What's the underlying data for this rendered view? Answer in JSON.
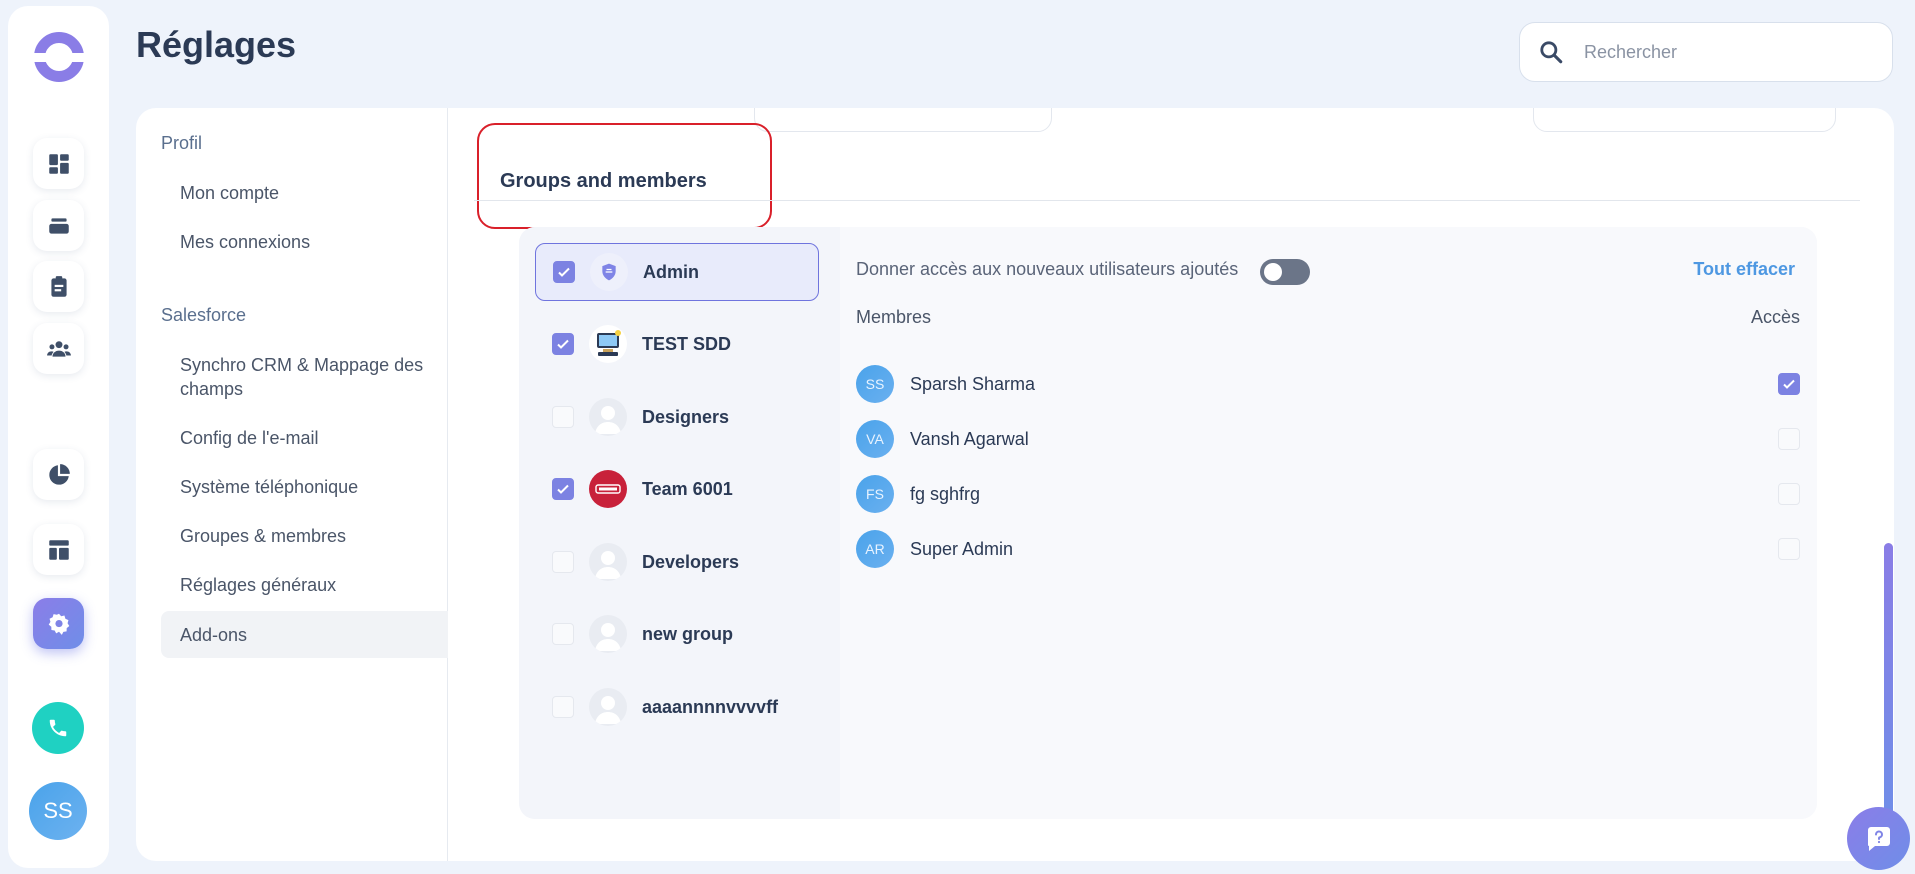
{
  "header": {
    "title": "Réglages",
    "search_placeholder": "Rechercher"
  },
  "rail": {
    "items": [
      {
        "icon": "dashboard-icon"
      },
      {
        "icon": "inbox-icon"
      },
      {
        "icon": "clipboard-icon"
      },
      {
        "icon": "team-icon"
      },
      {
        "icon": "pie-chart-icon"
      },
      {
        "icon": "layout-icon"
      },
      {
        "icon": "gear-icon",
        "active": true
      }
    ],
    "phone_icon": "phone-icon",
    "user_initials": "SS"
  },
  "settings_nav": {
    "sections": [
      {
        "label": "Profil",
        "items": [
          "Mon compte",
          "Mes connexions"
        ]
      },
      {
        "label": "Salesforce",
        "items": [
          "Synchro CRM & Mappage des champs",
          "Config de l'e-mail",
          "Système téléphonique",
          "Groupes & membres",
          "Réglages généraux",
          "Add-ons"
        ]
      }
    ],
    "active_item": "Add-ons"
  },
  "section_title": "Groups and members",
  "groups": [
    {
      "name": "Admin",
      "checked": true,
      "selected": true,
      "avatar": "shield-icon"
    },
    {
      "name": "TEST SDD",
      "checked": true,
      "avatar": "computer-icon"
    },
    {
      "name": "Designers",
      "checked": false,
      "avatar": "person-placeholder-icon"
    },
    {
      "name": "Team 6001",
      "checked": true,
      "avatar": "red-logo-icon"
    },
    {
      "name": "Developers",
      "checked": false,
      "avatar": "person-placeholder-icon"
    },
    {
      "name": "new group",
      "checked": false,
      "avatar": "person-placeholder-icon"
    },
    {
      "name": "aaaannnnvvvvff",
      "checked": false,
      "avatar": "person-placeholder-icon"
    }
  ],
  "members_panel": {
    "give_access_label": "Donner accès aux nouveaux utilisateurs ajoutés",
    "give_access_enabled": false,
    "clear_all_label": "Tout effacer",
    "members_header": "Membres",
    "access_header": "Accès",
    "members": [
      {
        "initials": "SS",
        "name": "Sparsh Sharma",
        "access": true
      },
      {
        "initials": "VA",
        "name": "Vansh Agarwal",
        "access": false
      },
      {
        "initials": "FS",
        "name": "fg sghfrg",
        "access": false
      },
      {
        "initials": "AR",
        "name": "Super Admin",
        "access": false
      }
    ]
  },
  "colors": {
    "accent": "#7c82e2",
    "link": "#4e98e2",
    "highlight_border": "#d9202a",
    "phone": "#1fd1c2"
  }
}
